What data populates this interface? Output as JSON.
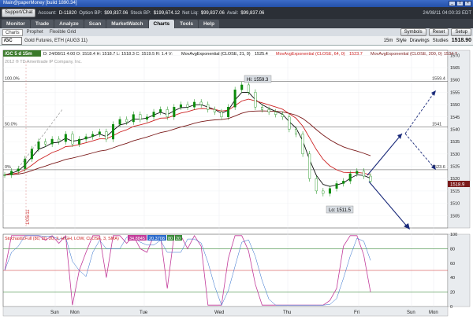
{
  "window": {
    "title": "Main@paperMoney [build 1890.34]"
  },
  "account": {
    "support_btn": "Support/Chat",
    "account_label": "Account:",
    "account_id": "D-11820",
    "option_bp_label": "Option BP:",
    "option_bp": "$99,837.06",
    "stock_bp_label": "Stock BP:",
    "stock_bp": "$199,674.12",
    "net_liq_label": "Net Liq:",
    "net_liq": "$99,837.06",
    "avail_label": "Avail:",
    "avail": "$99,837.06",
    "clock": "24/08/11 04:00:33 EDT"
  },
  "tabs": [
    {
      "label": "Monitor",
      "active": false
    },
    {
      "label": "Trade",
      "active": false
    },
    {
      "label": "Analyze",
      "active": false
    },
    {
      "label": "Scan",
      "active": false
    },
    {
      "label": "MarketWatch",
      "active": false
    },
    {
      "label": "Charts",
      "active": true
    },
    {
      "label": "Tools",
      "active": false
    },
    {
      "label": "Help",
      "active": false
    }
  ],
  "subtabs": [
    {
      "label": "Charts",
      "active": true
    },
    {
      "label": "Prophet",
      "active": false
    },
    {
      "label": "Flexible Grid",
      "active": false
    }
  ],
  "nav_buttons": {
    "symbols": "Symbols",
    "reset": "Reset",
    "setup": "Setup"
  },
  "toolbar": {
    "symbol": "/GC",
    "description": "Gold Futures, ETH (AUG3 11)",
    "interval": "15m",
    "style": "Style",
    "drawings": "Drawings",
    "studies": "Studies",
    "last_price": "1518.90"
  },
  "chart_data": [
    {
      "type": "line",
      "panel": "price",
      "legend": {
        "symbol": "/GC 5 d 15m",
        "readout": "D: 24/08/11 4:00  O: 1518.4  H: 1518.7  L: 1518.3  C: 1519.5  R: 1.4  V:",
        "studies": [
          {
            "label": "MovAvgExponential (CLOSE, 21, 0)",
            "value": "1525.4",
            "color": "#111111"
          },
          {
            "label": "MovAvgExponential (CLOSE, 64, 0)",
            "value": "1523.7",
            "color": "#cc2222"
          },
          {
            "label": "MovAvgExponential (CLOSE, 200, 0)",
            "value": "1534.7",
            "color": "#7a1a1a"
          }
        ]
      },
      "copyright": "2012 ® TD Ameritrade IP Company, Inc.",
      "y_ticks": [
        1570,
        1565,
        1560,
        1555,
        1550,
        1545,
        1540,
        1535,
        1530,
        1525,
        1520,
        1515,
        1510,
        1505
      ],
      "ylim": [
        1500,
        1572
      ],
      "x_labels": [
        "Sun",
        "Mon",
        "Tue",
        "Wed",
        "Thu",
        "Fri",
        "Sun",
        "Mon"
      ],
      "fib_levels": [
        {
          "label": "100.0%",
          "price": 1559.4,
          "value_label": "1559.4"
        },
        {
          "label": "50.0%",
          "price": 1541,
          "value_label": "1541"
        },
        {
          "label": "0%",
          "price": 1523.6,
          "value_label": "1523.6"
        }
      ],
      "annotations": [
        {
          "text": "Hi: 1559.3",
          "kind": "high"
        },
        {
          "text": "Lo: 1511.5",
          "kind": "low"
        },
        {
          "text": "1/05/11",
          "kind": "date"
        }
      ],
      "price_close": [
        1521.5,
        1523,
        1524,
        1528,
        1532,
        1535,
        1534,
        1536,
        1535,
        1538,
        1534,
        1536,
        1537,
        1538,
        1539,
        1536,
        1542,
        1544,
        1543,
        1546,
        1544,
        1545,
        1547,
        1548,
        1545,
        1549,
        1550,
        1549,
        1551,
        1550,
        1548,
        1547,
        1545,
        1549,
        1556,
        1558,
        1555,
        1549,
        1548,
        1547,
        1546,
        1545,
        1540,
        1538,
        1530,
        1520,
        1515,
        1514,
        1516,
        1518,
        1519,
        1522,
        1523,
        1521,
        1519
      ],
      "price_current": "1518.9"
    },
    {
      "type": "line",
      "panel": "oscillator",
      "legend": {
        "label": "StochasticFull (80, 20, 20, 3, HIGH, LOW, CLOSE, 3, SMA)",
        "fullk": "34.8845",
        "fulld": "20.3708",
        "over_bought": "80",
        "over_sold": "20"
      },
      "y_ticks": [
        100,
        80,
        60,
        40,
        20,
        0
      ],
      "ylim": [
        0,
        100
      ]
    }
  ]
}
